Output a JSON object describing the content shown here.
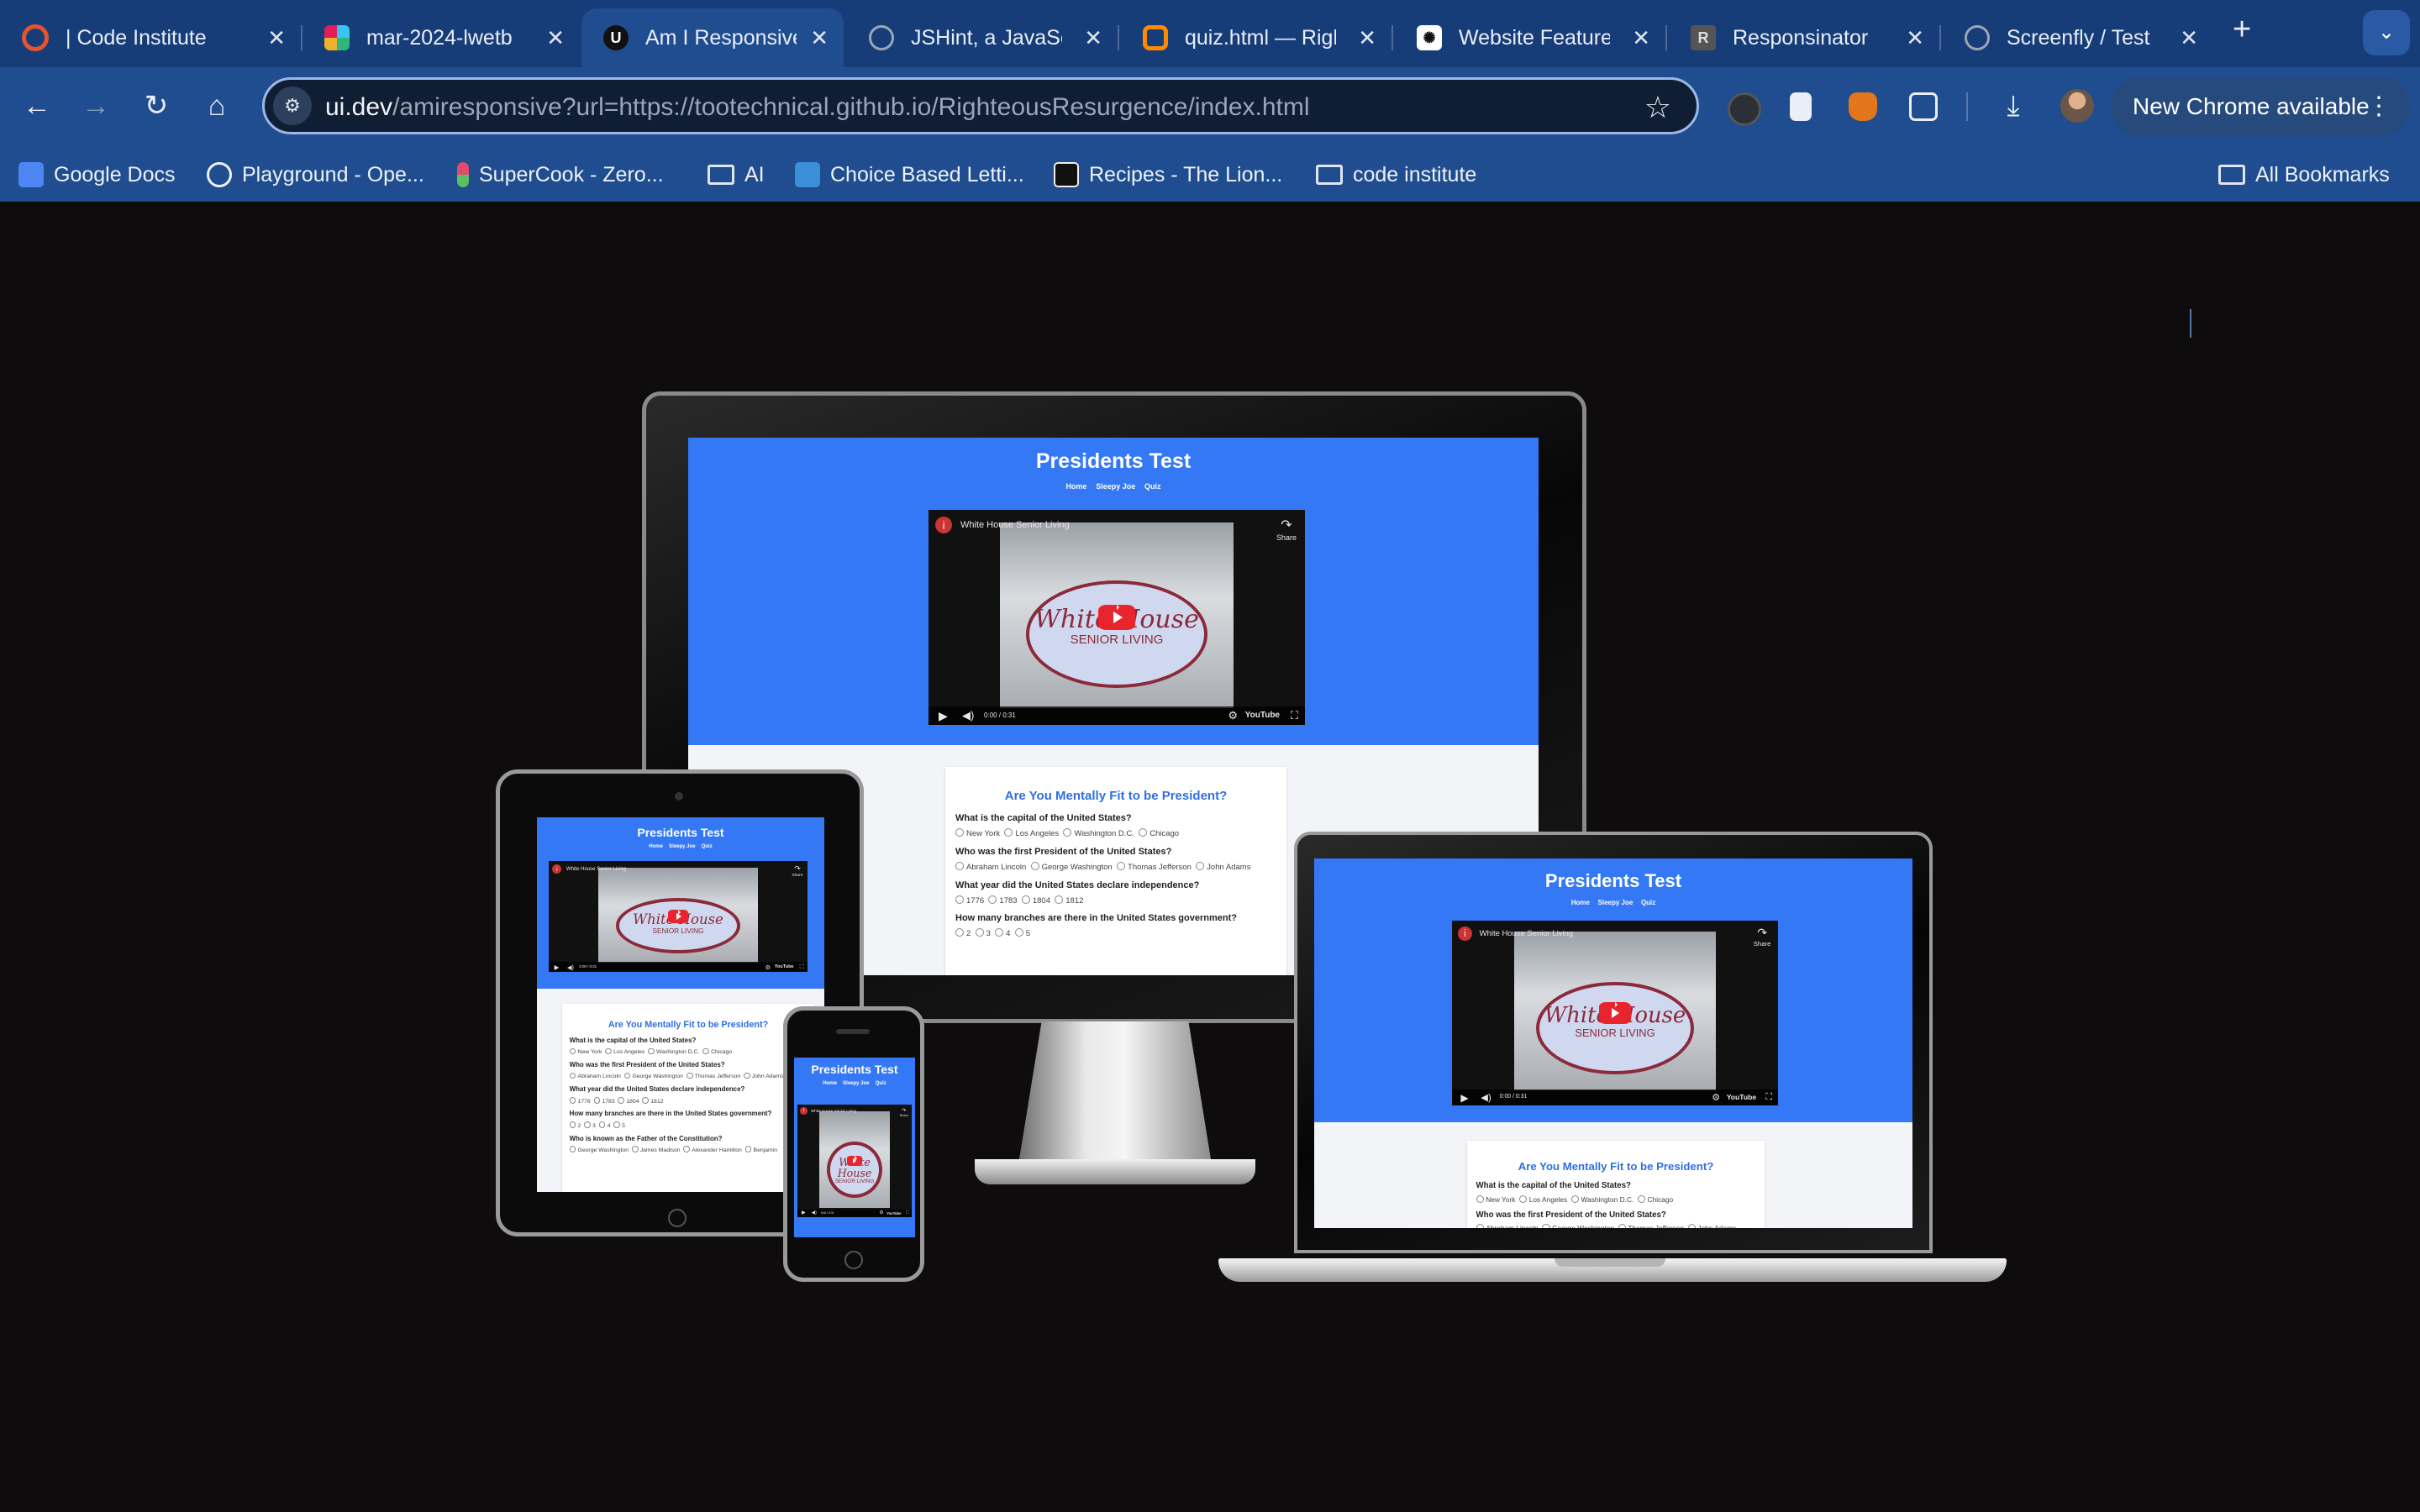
{
  "tabs": [
    {
      "title": "| Code Institute",
      "favicon": "code-institute-icon",
      "color": "#e5542f"
    },
    {
      "title": "mar-2024-lwetb",
      "favicon": "slack-icon",
      "color": "#e01e5a"
    },
    {
      "title": "Am I Responsive",
      "favicon": "ui-dev-icon",
      "color": "#111111"
    },
    {
      "title": "JSHint, a JavaSc",
      "favicon": "globe-icon",
      "color": "#9aa6b8"
    },
    {
      "title": "quiz.html — Righ",
      "favicon": "gitpod-icon",
      "color": "#ff8a00"
    },
    {
      "title": "Website Feature",
      "favicon": "openai-icon",
      "color": "#ffffff"
    },
    {
      "title": "Responsinator",
      "favicon": "r-icon",
      "color": "#555555"
    },
    {
      "title": "Screenfly / Test",
      "favicon": "globe-icon",
      "color": "#9aa6b8"
    }
  ],
  "omnibox": {
    "host": "ui.dev",
    "path": "/amiresponsive?url=https://tootechnical.github.io/RighteousResurgence/index.html"
  },
  "new_chrome_label": "New Chrome available",
  "bookmarks": [
    {
      "label": "Google Docs",
      "icon": "google-docs-icon"
    },
    {
      "label": "Playground - Ope...",
      "icon": "openai-icon"
    },
    {
      "label": "SuperCook - Zero...",
      "icon": "supercook-icon"
    },
    {
      "label": "AI",
      "icon": "folder-icon"
    },
    {
      "label": "Choice Based Letti...",
      "icon": "choice-icon"
    },
    {
      "label": "Recipes - The Lion...",
      "icon": "lion-icon"
    },
    {
      "label": "code institute",
      "icon": "folder-icon"
    }
  ],
  "all_bookmarks_label": "All Bookmarks",
  "site": {
    "title": "Presidents Test",
    "nav": [
      "Home",
      "Sleepy Joe",
      "Quiz"
    ],
    "video_title": "White House Senior Living",
    "video_logo_top": "White House",
    "video_logo_bottom": "SENIOR LIVING",
    "video_share": "Share",
    "video_time": "0:00 / 0:31",
    "video_brand": "YouTube",
    "quiz_title": "Are You Mentally Fit to be President?",
    "questions": [
      {
        "q": "What is the capital of the United States?",
        "options": [
          "New York",
          "Los Angeles",
          "Washington D.C.",
          "Chicago"
        ]
      },
      {
        "q": "Who was the first President of the United States?",
        "options": [
          "Abraham Lincoln",
          "George Washington",
          "Thomas Jefferson",
          "John Adams"
        ]
      },
      {
        "q": "What year did the United States declare independence?",
        "options": [
          "1776",
          "1783",
          "1804",
          "1812"
        ]
      },
      {
        "q": "How many branches are there in the United States government?",
        "options": [
          "2",
          "3",
          "4",
          "5"
        ]
      },
      {
        "q": "Who is known as the Father of the Constitution?",
        "options": [
          "George Washington",
          "James Madison",
          "Alexander Hamilton",
          "Benjamin"
        ]
      }
    ]
  },
  "colors": {
    "site_blue": "#3478f6",
    "quiz_title": "#2f6fe0",
    "page_bg": "#0e0c0c"
  }
}
